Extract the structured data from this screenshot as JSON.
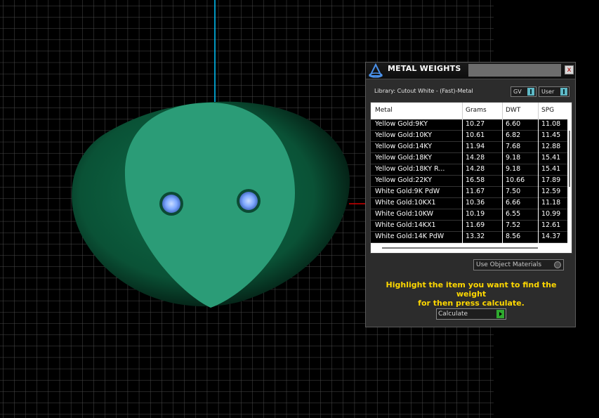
{
  "panel": {
    "title": "METAL WEIGHTS",
    "close_glyph": "x",
    "library_label": "Library: Cutout White - (Fast)-Metal",
    "gv_toggle_label": "GV",
    "user_toggle_label": "User",
    "columns": [
      "Metal",
      "Grams",
      "DWT",
      "SPG"
    ],
    "rows": [
      {
        "metal": "Yellow Gold:9KY",
        "grams": "10.27",
        "dwt": "6.60",
        "spg": "11.08"
      },
      {
        "metal": "Yellow Gold:10KY",
        "grams": "10.61",
        "dwt": "6.82",
        "spg": "11.45"
      },
      {
        "metal": "Yellow Gold:14KY",
        "grams": "11.94",
        "dwt": "7.68",
        "spg": "12.88"
      },
      {
        "metal": "Yellow Gold:18KY",
        "grams": "14.28",
        "dwt": "9.18",
        "spg": "15.41"
      },
      {
        "metal": "Yellow Gold:18KY R...",
        "grams": "14.28",
        "dwt": "9.18",
        "spg": "15.41"
      },
      {
        "metal": "Yellow Gold:22KY",
        "grams": "16.58",
        "dwt": "10.66",
        "spg": "17.89"
      },
      {
        "metal": "White Gold:9K PdW",
        "grams": "11.67",
        "dwt": "7.50",
        "spg": "12.59"
      },
      {
        "metal": "White Gold:10KX1",
        "grams": "10.36",
        "dwt": "6.66",
        "spg": "11.18"
      },
      {
        "metal": "White Gold:10KW",
        "grams": "10.19",
        "dwt": "6.55",
        "spg": "10.99"
      },
      {
        "metal": "White Gold:14KX1",
        "grams": "11.69",
        "dwt": "7.52",
        "spg": "12.61"
      },
      {
        "metal": "White Gold:14K PdW",
        "grams": "13.32",
        "dwt": "8.56",
        "spg": "14.37"
      }
    ],
    "material_dropdown": "Use Object Materials",
    "instructions_line1": "Highlight the item you want to find the weight",
    "instructions_line2": "for then press calculate.",
    "calculate_label": "Calculate"
  },
  "icons": {
    "app": "metal-weights-app-icon",
    "close": "close-icon",
    "toggle": "toggle-knob-icon",
    "dropdown": "dropdown-arrow-icon",
    "calculate": "play-arrow-icon"
  },
  "colors": {
    "viewport_background": "#000000",
    "grid_line": "#4a4a4a",
    "shape_dark": "#0f5a3c",
    "shape_face": "#2b9c77",
    "gem": "#8ab4ff",
    "axis_cyan": "#00c8ff",
    "instructions_text": "#ffd800",
    "toggle_accent": "#5fb9c6",
    "calculate_accent": "#2faa2f"
  }
}
